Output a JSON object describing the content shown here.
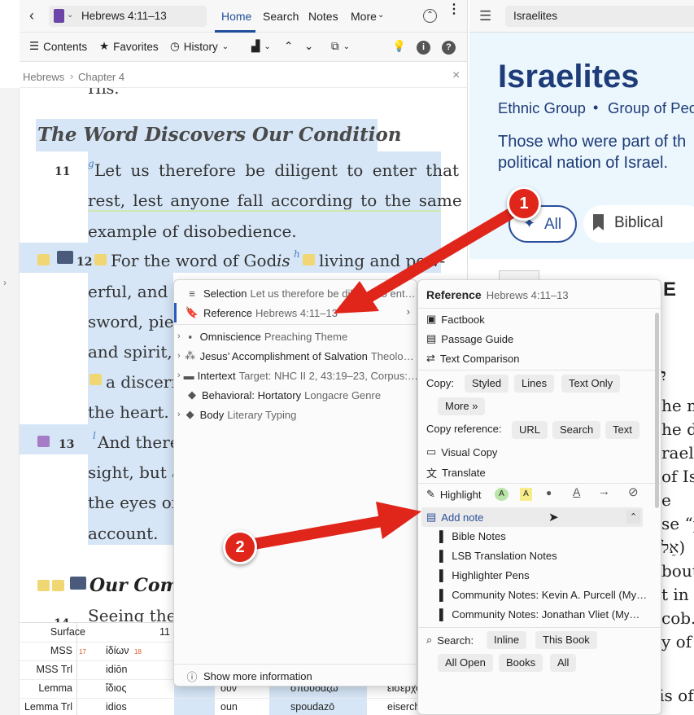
{
  "left": {
    "reference": "Hebrews 4:11–13",
    "tabs": [
      "Home",
      "Search",
      "Notes",
      "More"
    ],
    "toolbar": {
      "contents": "Contents",
      "favorites": "Favorites",
      "history": "History"
    },
    "breadcrumb": [
      "Hebrews",
      "Chapter 4"
    ],
    "partial_top": "His.",
    "heading": "The Word Discovers Our Condition",
    "v11": {
      "num": "11",
      "mark": "g",
      "line1": "Let us therefore be diligent to enter that",
      "line2": "rest, lest anyone fall according to the same",
      "line3": "example of disobedience."
    },
    "v12": {
      "num": "12",
      "l1a": "For the word of God",
      "l1b": "is",
      "mark": "h",
      "l1c": "living and pow-",
      "l2": "erful,  and",
      "l3": "sword,  pie",
      "l4": "and spirit,",
      "l5": "a  discern",
      "l6": "the heart."
    },
    "v13": {
      "num": "13",
      "mark": "l",
      "l1": "And  there",
      "l2": "sight, but a",
      "l3": "the eyes of",
      "l4": "account."
    },
    "heading2": "Our Com",
    "v14_partial": "Seeing ther",
    "v14_num": "14",
    "interlinear": {
      "labels": [
        "Surface",
        "MSS",
        "MSS Trl",
        "Lemma",
        "Lemma Trl"
      ],
      "num": "11",
      "mss_word": "ἰδίων",
      "mss_n1": "17",
      "mss_n2": "18",
      "msstrl": "idiōn",
      "lemma": [
        "ἴδιος",
        "οὖν",
        "σπουδάζω",
        "εἰσέρχομαι"
      ],
      "lemmatrl": [
        "idios",
        "oun",
        "spoudazō",
        "eiserchomai"
      ]
    }
  },
  "right": {
    "search": "Israelites",
    "title": "Israelites",
    "subtitle_a": "Ethnic Group",
    "subtitle_b": "Group of Peo",
    "desc1": "Those who were part of th",
    "desc2": "political nation of Israel.",
    "pill_all": "All",
    "pill_biblical": "Biblical",
    "side_title": "m E",
    "hebrew": "יִשְׂ",
    "lines": [
      "he m",
      "he de",
      "rael)",
      "of Isr",
      "e",
      "se “p",
      "אֵל)",
      "bout",
      "t in r",
      "cob. T",
      "y of I"
    ],
    "bottom": "phrase “sons of” is ofte"
  },
  "context_menu": {
    "items": [
      {
        "label": "Selection",
        "sub": "Let us therefore be diligent to ent…",
        "icon": "lines-icon"
      },
      {
        "label": "Reference",
        "sub": "Hebrews 4:11–13",
        "icon": "bookmark-icon"
      },
      {
        "label": "Omniscience",
        "sub": "Preaching Theme",
        "icon": "podium-icon"
      },
      {
        "label": "Jesus’ Accomplishment of Salvation",
        "sub": "Theolo…",
        "icon": "hierarchy-icon"
      },
      {
        "label": "Intertext",
        "sub": "Target: NHC II 2, 43:19–23, Corpus:…",
        "icon": "tag-icon"
      },
      {
        "label": "Behavioral: Hortatory",
        "sub": "Longacre Genre",
        "icon": "diamond-icon"
      },
      {
        "label": "Body",
        "sub": "Literary Typing",
        "icon": "diamond-icon"
      }
    ],
    "footer": "Show more information"
  },
  "submenu": {
    "title": "Reference",
    "title_sub": "Hebrews 4:11–13",
    "factbook": "Factbook",
    "passage_guide": "Passage Guide",
    "text_comparison": "Text Comparison",
    "copy_label": "Copy:",
    "copy_buttons": [
      "Styled",
      "Lines",
      "Text Only",
      "More »"
    ],
    "copyref_label": "Copy reference:",
    "copyref_buttons": [
      "URL",
      "Search",
      "Text"
    ],
    "visual_copy": "Visual Copy",
    "translate": "Translate",
    "highlight": "Highlight",
    "add_note": "Add note",
    "notes": [
      "Bible Notes",
      "LSB Translation Notes",
      "Highlighter Pens",
      "Community Notes: Kevin A. Purcell (My…",
      "Community Notes: Jonathan Vliet (My…"
    ],
    "search_label": "Search:",
    "search_buttons": [
      "Inline",
      "This Book",
      "All Open",
      "Books",
      "All"
    ]
  },
  "annotations": {
    "one": "1",
    "two": "2"
  },
  "colors": {
    "accent": "#1f4e9c",
    "arrow": "#e0251b",
    "highlight_blue": "#d6e6f7",
    "note_yellow": "#f1d774"
  }
}
